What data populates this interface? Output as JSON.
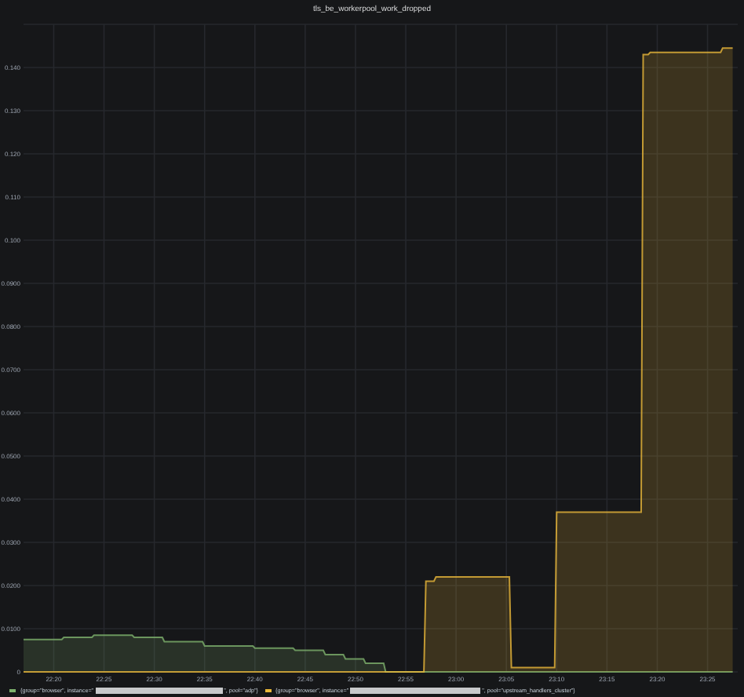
{
  "panel": {
    "title": "tls_be_workerpool_work_dropped"
  },
  "chart_data": {
    "type": "area",
    "stacked": false,
    "grid": true,
    "x": [
      1337,
      1340.8,
      1341,
      1343.8,
      1344,
      1347.8,
      1348,
      1350.8,
      1351,
      1354.8,
      1355,
      1359.8,
      1360,
      1363.8,
      1364,
      1366.8,
      1367,
      1368.8,
      1369,
      1370.8,
      1371,
      1372.8,
      1373,
      1376.8,
      1377,
      1377.8,
      1378,
      1385.3,
      1385.5,
      1389.8,
      1390,
      1398.4,
      1398.6,
      1399.1,
      1399.3,
      1406.3,
      1406.5,
      1407.5
    ],
    "series": [
      {
        "color": "#7eb26d",
        "values": [
          0.0075,
          0.0075,
          0.008,
          0.008,
          0.0085,
          0.0085,
          0.008,
          0.008,
          0.007,
          0.007,
          0.006,
          0.006,
          0.0055,
          0.0055,
          0.005,
          0.005,
          0.004,
          0.004,
          0.003,
          0.003,
          0.002,
          0.002,
          0,
          0,
          0,
          0,
          0,
          0,
          0,
          0,
          0,
          0,
          0,
          0,
          0,
          0,
          0,
          0
        ]
      },
      {
        "color": "#eab839",
        "values": [
          0,
          0,
          0,
          0,
          0,
          0,
          0,
          0,
          0,
          0,
          0,
          0,
          0,
          0,
          0,
          0,
          0,
          0,
          0,
          0,
          0,
          0,
          0,
          0,
          0.021,
          0.021,
          0.022,
          0.022,
          0.001,
          0.001,
          0.037,
          0.037,
          0.143,
          0.143,
          0.1435,
          0.1435,
          0.1445,
          0.1445
        ]
      }
    ],
    "xlim": [
      1337,
      1408
    ],
    "ylim": [
      0,
      0.15
    ],
    "xticks": [
      {
        "value": 1340,
        "label": "22:20"
      },
      {
        "value": 1345,
        "label": "22:25"
      },
      {
        "value": 1350,
        "label": "22:30"
      },
      {
        "value": 1355,
        "label": "22:35"
      },
      {
        "value": 1360,
        "label": "22:40"
      },
      {
        "value": 1365,
        "label": "22:45"
      },
      {
        "value": 1370,
        "label": "22:50"
      },
      {
        "value": 1375,
        "label": "22:55"
      },
      {
        "value": 1380,
        "label": "23:00"
      },
      {
        "value": 1385,
        "label": "23:05"
      },
      {
        "value": 1390,
        "label": "23:10"
      },
      {
        "value": 1395,
        "label": "23:15"
      },
      {
        "value": 1400,
        "label": "23:20"
      },
      {
        "value": 1405,
        "label": "23:25"
      }
    ],
    "yticks": [
      {
        "value": 0,
        "label": "0"
      },
      {
        "value": 0.01,
        "label": "0.0100"
      },
      {
        "value": 0.02,
        "label": "0.0200"
      },
      {
        "value": 0.03,
        "label": "0.0300"
      },
      {
        "value": 0.04,
        "label": "0.0400"
      },
      {
        "value": 0.05,
        "label": "0.0500"
      },
      {
        "value": 0.06,
        "label": "0.0600"
      },
      {
        "value": 0.07,
        "label": "0.0700"
      },
      {
        "value": 0.08,
        "label": "0.0800"
      },
      {
        "value": 0.09,
        "label": "0.0900"
      },
      {
        "value": 0.1,
        "label": "0.100"
      },
      {
        "value": 0.11,
        "label": "0.110"
      },
      {
        "value": 0.12,
        "label": "0.120"
      },
      {
        "value": 0.13,
        "label": "0.130"
      },
      {
        "value": 0.14,
        "label": "0.140"
      }
    ]
  },
  "legend": [
    {
      "color": "#7eb26d",
      "prefix": "{group=\"browser\", instance=\"",
      "suffix": "\", pool=\"adp\"}"
    },
    {
      "color": "#eab839",
      "prefix": "{group=\"browser\", instance=\"",
      "suffix": "\", pool=\"upstream_handlers_cluster\"}"
    }
  ]
}
